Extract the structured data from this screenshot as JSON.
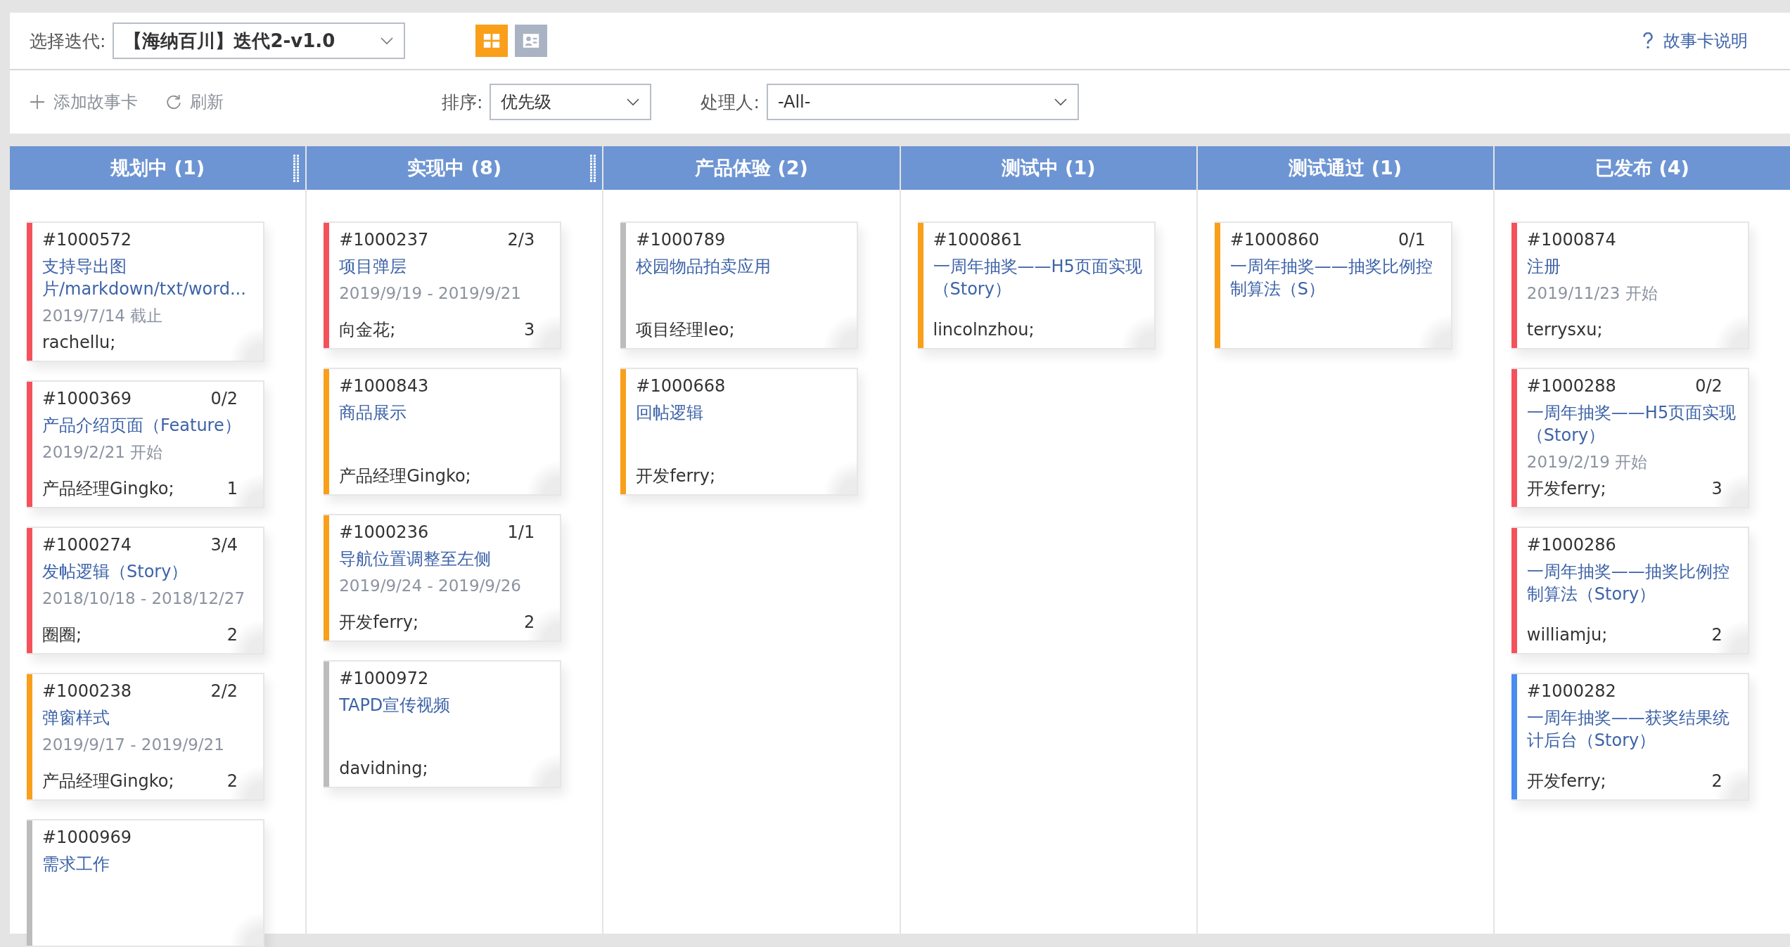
{
  "header": {
    "iteration_label": "选择迭代:",
    "iteration_value": "【海纳百川】迭代2-v1.0",
    "views": [
      {
        "kind": "board",
        "selected": true
      },
      {
        "kind": "person",
        "selected": false
      }
    ],
    "help_link": "故事卡说明"
  },
  "toolbar": {
    "add_button": "添加故事卡",
    "refresh_button": "刷新",
    "sort_label": "排序:",
    "sort_value": "优先级",
    "owner_label": "处理人:",
    "owner_value": "-All-"
  },
  "columns": [
    {
      "title": "规划中 (1)",
      "resizable": true,
      "cards": [
        {
          "id": "#1000572",
          "title": "支持导出图片/markdown/txt/word...",
          "date": "2019/7/14 截止",
          "owner": "rachellu;",
          "color": "#f5515b"
        },
        {
          "id": "#1000369",
          "progress": "0/2",
          "title": "产品介绍页面（Feature）",
          "date": "2019/2/21 开始",
          "owner": "产品经理Gingko;",
          "count": "1",
          "color": "#f5515b"
        },
        {
          "id": "#1000274",
          "progress": "3/4",
          "title": "发帖逻辑（Story）",
          "date": "2018/10/18 - 2018/12/27",
          "owner": "圈圈;",
          "count": "2",
          "color": "#f5515b"
        },
        {
          "id": "#1000238",
          "progress": "2/2",
          "title": "弹窗样式",
          "date": "2019/9/17 - 2019/9/21",
          "owner": "产品经理Gingko;",
          "count": "2",
          "color": "#f99f1a"
        },
        {
          "id": "#1000969",
          "title": "需求工作",
          "color": "#bcbcbc"
        }
      ]
    },
    {
      "title": "实现中 (8)",
      "resizable": true,
      "cards": [
        {
          "id": "#1000237",
          "progress": "2/3",
          "title": "项目弹层",
          "date": "2019/9/19 - 2019/9/21",
          "owner": "向金花;",
          "count": "3",
          "color": "#f5515b"
        },
        {
          "id": "#1000843",
          "title": "商品展示",
          "owner": "产品经理Gingko;",
          "color": "#f99f1a"
        },
        {
          "id": "#1000236",
          "progress": "1/1",
          "title": "导航位置调整至左侧",
          "date": "2019/9/24 - 2019/9/26",
          "owner": "开发ferry;",
          "count": "2",
          "color": "#f99f1a"
        },
        {
          "id": "#1000972",
          "title": "TAPD宣传视频",
          "owner": "davidning;",
          "color": "#bcbcbc"
        }
      ]
    },
    {
      "title": "产品体验 (2)",
      "resizable": false,
      "cards": [
        {
          "id": "#1000789",
          "title": "校园物品拍卖应用",
          "owner": "项目经理leo;",
          "color": "#bcbcbc"
        },
        {
          "id": "#1000668",
          "title": "回帖逻辑",
          "owner": "开发ferry;",
          "color": "#f99f1a"
        }
      ]
    },
    {
      "title": "测试中 (1)",
      "resizable": false,
      "cards": [
        {
          "id": "#1000861",
          "title": "一周年抽奖——H5页面实现（Story）",
          "owner": "lincolnzhou;",
          "color": "#f99f1a"
        }
      ]
    },
    {
      "title": "测试通过 (1)",
      "resizable": false,
      "cards": [
        {
          "id": "#1000860",
          "progress": "0/1",
          "title": "一周年抽奖——抽奖比例控制算法（S）",
          "color": "#f99f1a"
        }
      ]
    },
    {
      "title": "已发布 (4)",
      "resizable": false,
      "cards": [
        {
          "id": "#1000874",
          "title": "注册",
          "date": "2019/11/23 开始",
          "owner": "terrysxu;",
          "color": "#f5515b"
        },
        {
          "id": "#1000288",
          "progress": "0/2",
          "title": "一周年抽奖——H5页面实现（Story）",
          "date": "2019/2/19 开始",
          "owner": "开发ferry;",
          "count": "3",
          "color": "#f5515b"
        },
        {
          "id": "#1000286",
          "title": "一周年抽奖——抽奖比例控制算法（Story）",
          "owner": "williamju;",
          "count": "2",
          "color": "#f5515b"
        },
        {
          "id": "#1000282",
          "title": "一周年抽奖——获奖结果统计后台（Story）",
          "owner": "开发ferry;",
          "count": "2",
          "color": "#4a8cf0"
        }
      ]
    }
  ]
}
